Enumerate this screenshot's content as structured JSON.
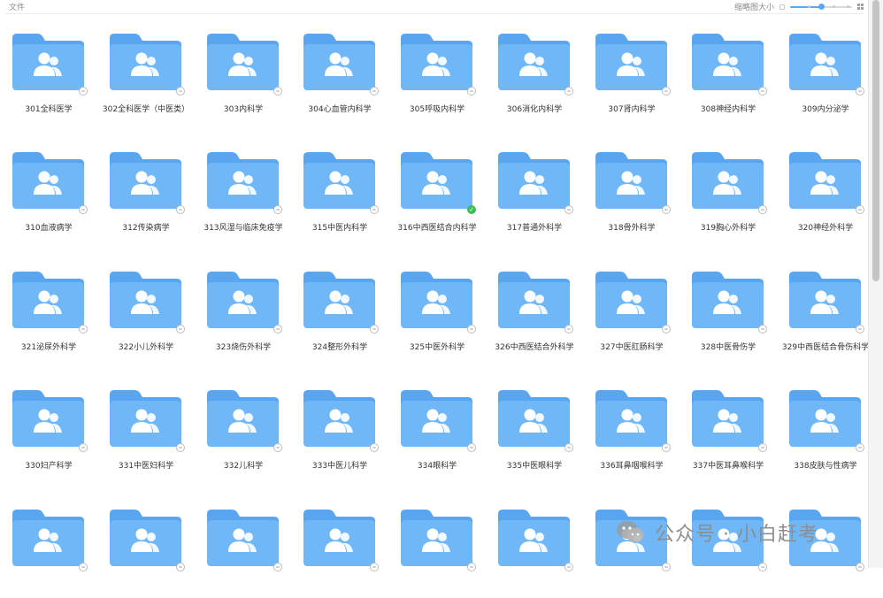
{
  "header": {
    "title": "文件",
    "thumbnail_size_label": "缩略图大小",
    "thumbnail_size_level": 0.5
  },
  "colors": {
    "folder_body": "#6fb7f7",
    "folder_tab": "#5aa5f0",
    "accent": "#5aa7f3",
    "synced": "#3cbf54"
  },
  "icons": {
    "folder": "folder-people-icon",
    "cloud_status": "cloud-icon",
    "synced_status": "check-circle-icon"
  },
  "folders": [
    {
      "label": "301全科医学",
      "synced": false
    },
    {
      "label": "302全科医学（中医类）",
      "synced": false
    },
    {
      "label": "303内科学",
      "synced": false
    },
    {
      "label": "304心血管内科学",
      "synced": false
    },
    {
      "label": "305呼吸内科学",
      "synced": false
    },
    {
      "label": "306消化内科学",
      "synced": false
    },
    {
      "label": "307肾内科学",
      "synced": false
    },
    {
      "label": "308神经内科学",
      "synced": false
    },
    {
      "label": "309内分泌学",
      "synced": false
    },
    {
      "label": "310血液病学",
      "synced": false
    },
    {
      "label": "312传染病学",
      "synced": false
    },
    {
      "label": "313风湿与临床免疫学",
      "synced": false
    },
    {
      "label": "315中医内科学",
      "synced": false
    },
    {
      "label": "316中西医结合内科学",
      "synced": true
    },
    {
      "label": "317普通外科学",
      "synced": false
    },
    {
      "label": "318骨外科学",
      "synced": false
    },
    {
      "label": "319胸心外科学",
      "synced": false
    },
    {
      "label": "320神经外科学",
      "synced": false
    },
    {
      "label": "321泌尿外科学",
      "synced": false
    },
    {
      "label": "322小儿外科学",
      "synced": false
    },
    {
      "label": "323烧伤外科学",
      "synced": false
    },
    {
      "label": "324整形外科学",
      "synced": false
    },
    {
      "label": "325中医外科学",
      "synced": false
    },
    {
      "label": "326中西医结合外科学",
      "synced": false
    },
    {
      "label": "327中医肛肠科学",
      "synced": false
    },
    {
      "label": "328中医骨伤学",
      "synced": false
    },
    {
      "label": "329中西医结合骨伤科学",
      "synced": false
    },
    {
      "label": "330妇产科学",
      "synced": false
    },
    {
      "label": "331中医妇科学",
      "synced": false
    },
    {
      "label": "332儿科学",
      "synced": false
    },
    {
      "label": "333中医儿科学",
      "synced": false
    },
    {
      "label": "334眼科学",
      "synced": false
    },
    {
      "label": "335中医眼科学",
      "synced": false
    },
    {
      "label": "336耳鼻咽喉科学",
      "synced": false
    },
    {
      "label": "337中医耳鼻喉科学",
      "synced": false
    },
    {
      "label": "338皮肤与性病学",
      "synced": false
    },
    {
      "label": "",
      "synced": false
    },
    {
      "label": "",
      "synced": false
    },
    {
      "label": "",
      "synced": false
    },
    {
      "label": "",
      "synced": false
    },
    {
      "label": "",
      "synced": false
    },
    {
      "label": "",
      "synced": false
    },
    {
      "label": "",
      "synced": false
    },
    {
      "label": "",
      "synced": false
    },
    {
      "label": "",
      "synced": false
    }
  ],
  "watermark": {
    "text": "公众号 · 小白赶考"
  }
}
